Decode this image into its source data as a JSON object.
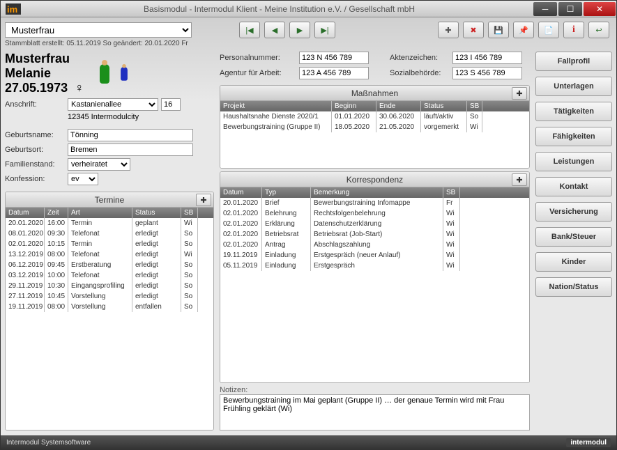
{
  "window": {
    "title": "Basismodul - Intermodul Klient - Meine Institution e.V. / Gesellschaft mbH"
  },
  "header": {
    "client_selected": "Musterfrau",
    "meta": "Stammblatt erstellt: 05.11.2019 So   geändert: 20.01.2020 Fr"
  },
  "person": {
    "lastname": "Musterfrau",
    "firstname": "Melanie",
    "dob": "27.05.1973",
    "gender_symbol": "♀"
  },
  "address": {
    "label": "Anschrift:",
    "street": "Kastanienallee",
    "number": "16",
    "cityline": "12345 Intermodulcity"
  },
  "fields": {
    "birthname_label": "Geburtsname:",
    "birthname": "Tönning",
    "birthplace_label": "Geburtsort:",
    "birthplace": "Bremen",
    "marital_label": "Familienstand:",
    "marital": "verheiratet",
    "confession_label": "Konfession:",
    "confession": "ev"
  },
  "ids": {
    "personalnr_label": "Personalnummer:",
    "personalnr": "123 N 456 789",
    "agentur_label": "Agentur für Arbeit:",
    "agentur": "123 A 456 789",
    "aktenzeichen_label": "Aktenzeichen:",
    "aktenzeichen": "123 I 456 789",
    "sozial_label": "Sozialbehörde:",
    "sozial": "123 S 456 789"
  },
  "sidebar": {
    "items": [
      "Fallprofil",
      "Unterlagen",
      "Tätigkeiten",
      "Fähigkeiten",
      "Leistungen",
      "Kontakt",
      "Versicherung",
      "Bank/Steuer",
      "Kinder",
      "Nation/Status"
    ]
  },
  "panels": {
    "termine": {
      "title": "Termine",
      "cols": [
        "Datum",
        "Zeit",
        "Art",
        "Status",
        "SB"
      ],
      "rows": [
        [
          "20.01.2020",
          "16:00",
          "Termin",
          "geplant",
          "Wi"
        ],
        [
          "08.01.2020",
          "09:30",
          "Telefonat",
          "erledigt",
          "So"
        ],
        [
          "02.01.2020",
          "10:15",
          "Termin",
          "erledigt",
          "So"
        ],
        [
          "13.12.2019",
          "08:00",
          "Telefonat",
          "erledigt",
          "Wi"
        ],
        [
          "06.12.2019",
          "09:45",
          "Erstberatung",
          "erledigt",
          "So"
        ],
        [
          "03.12.2019",
          "10:00",
          "Telefonat",
          "erledigt",
          "So"
        ],
        [
          "29.11.2019",
          "10:30",
          "Eingangsprofiling",
          "erledigt",
          "So"
        ],
        [
          "27.11.2019",
          "10:45",
          "Vorstellung",
          "erledigt",
          "So"
        ],
        [
          "19.11.2019",
          "08:00",
          "Vorstellung",
          "entfallen",
          "So"
        ]
      ]
    },
    "massnahmen": {
      "title": "Maßnahmen",
      "cols": [
        "Projekt",
        "Beginn",
        "Ende",
        "Status",
        "SB"
      ],
      "rows": [
        [
          "Haushaltsnahe Dienste 2020/1",
          "01.01.2020",
          "30.06.2020",
          "läuft/aktiv",
          "So"
        ],
        [
          "Bewerbungstraining (Gruppe II)",
          "18.05.2020",
          "21.05.2020",
          "vorgemerkt",
          "Wi"
        ]
      ]
    },
    "korrespondenz": {
      "title": "Korrespondenz",
      "cols": [
        "Datum",
        "Typ",
        "Bemerkung",
        "SB"
      ],
      "rows": [
        [
          "20.01.2020",
          "Brief",
          "Bewerbungstraining Infomappe",
          "Fr"
        ],
        [
          "02.01.2020",
          "Belehrung",
          "Rechtsfolgenbelehrung",
          "Wi"
        ],
        [
          "02.01.2020",
          "Erklärung",
          "Datenschutzerklärung",
          "Wi"
        ],
        [
          "02.01.2020",
          "Betriebsrat",
          "Betriebsrat (Job-Start)",
          "Wi"
        ],
        [
          "02.01.2020",
          "Antrag",
          "Abschlagszahlung",
          "Wi"
        ],
        [
          "19.11.2019",
          "Einladung",
          "Erstgespräch (neuer Anlauf)",
          "Wi"
        ],
        [
          "05.11.2019",
          "Einladung",
          "Erstgespräch",
          "Wi"
        ]
      ]
    }
  },
  "notes": {
    "label": "Notizen:",
    "text": "Bewerbungstraining im Mai geplant (Gruppe II) … der genaue Termin wird mit Frau Frühling geklärt (Wi)"
  },
  "footer": {
    "vendor": "Intermodul Systemsoftware",
    "brand": "intermodul"
  }
}
